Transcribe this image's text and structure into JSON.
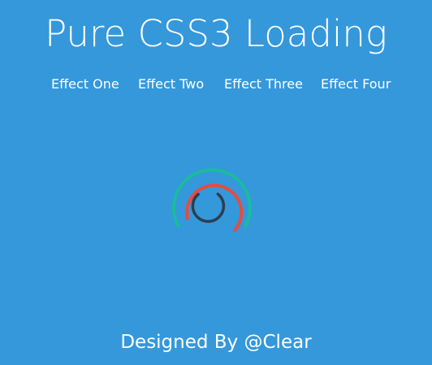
{
  "header": {
    "title": "Pure CSS3 Loading"
  },
  "nav": {
    "items": [
      {
        "label": "Effect One"
      },
      {
        "label": "Effect Two"
      },
      {
        "label": "Effect Three"
      },
      {
        "label": "Effect Four"
      }
    ]
  },
  "loader": {
    "colors": {
      "outer": "#1abc9c",
      "middle": "#e74c3c",
      "inner": "#2c3e50"
    }
  },
  "footer": {
    "credit": "Designed By @Clear"
  },
  "colors": {
    "background": "#3498db",
    "text": "#ffffff"
  }
}
